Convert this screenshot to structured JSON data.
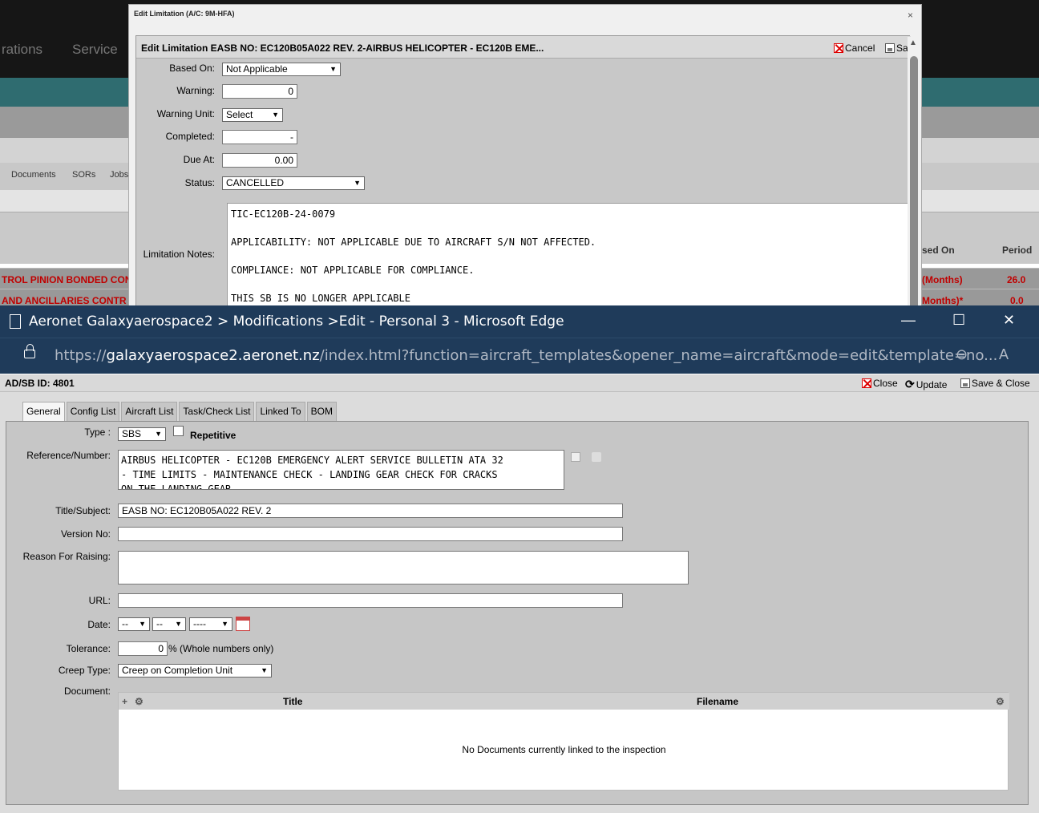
{
  "background_app": {
    "nav": [
      "rations",
      "Service"
    ],
    "tabs": [
      "Documents",
      "SORs",
      "Jobs"
    ],
    "column_headers": [
      "sed On",
      "Period"
    ],
    "rows": [
      {
        "left": "TROL PINION BONDED CON",
        "based_on": "(Months)",
        "period": "26.0"
      },
      {
        "left": "AND ANCILLARIES CONTR",
        "based_on": "Months)*",
        "period": "0.0"
      }
    ]
  },
  "limitation_dialog": {
    "window_title": "Edit Limitation (A/C: 9M-HFA)",
    "close_glyph": "×",
    "header_title": "Edit Limitation EASB NO: EC120B05A022 REV. 2-AIRBUS HELICOPTER - EC120B EME...",
    "cancel_label": "Cancel",
    "save_label": "Sa",
    "fields": {
      "based_on_label": "Based On:",
      "based_on_value": "Not Applicable",
      "warning_label": "Warning:",
      "warning_value": "0",
      "warning_unit_label": "Warning Unit:",
      "warning_unit_value": "Select",
      "completed_label": "Completed:",
      "completed_value": "-",
      "due_at_label": "Due At:",
      "due_at_value": "0.00",
      "status_label": "Status:",
      "status_value": "CANCELLED",
      "notes_label": "Limitation Notes:"
    },
    "notes": [
      "TIC-EC120B-24-0079",
      "APPLICABILITY: NOT APPLICABLE DUE TO AIRCRAFT S/N NOT AFFECTED.",
      "COMPLIANCE: NOT APPLICABLE FOR COMPLIANCE.",
      "THIS SB IS NO LONGER APPLICABLE"
    ]
  },
  "browser": {
    "title": "Aeronet Galaxyaerospace2 > Modifications >Edit - Personal 3 - Microsoft Edge",
    "url_prefix": "https://",
    "url_domain": "galaxyaerospace2.aeronet.nz",
    "url_rest": "/index.html?function=aircraft_templates&opener_name=aircraft&mode=edit&template=no...",
    "minimize_glyph": "—",
    "maximize_glyph": "☐",
    "close_glyph": "✕"
  },
  "adsb_page": {
    "id_label": "AD/SB ID: 4801",
    "close_label": "Close",
    "update_label": "Update",
    "save_close_label": "Save & Close",
    "tabs": [
      "General",
      "Config List",
      "Aircraft List",
      "Task/Check List",
      "Linked To",
      "BOM"
    ],
    "form": {
      "type_label": "Type :",
      "type_value": "SBS",
      "repetitive_label": "Repetitive",
      "reference_label": "Reference/Number:",
      "reference_lines": [
        "AIRBUS HELICOPTER - EC120B EMERGENCY ALERT SERVICE BULLETIN ATA 32",
        "- TIME LIMITS - MAINTENANCE CHECK - LANDING GEAR CHECK FOR CRACKS",
        "ON THE LANDING GEAR"
      ],
      "title_label": "Title/Subject:",
      "title_value": "EASB NO: EC120B05A022 REV. 2",
      "version_label": "Version No:",
      "version_value": "",
      "reason_label": "Reason For Raising:",
      "reason_value": "",
      "url_label": "URL:",
      "url_value": "",
      "date_label": "Date:",
      "date_day": "--",
      "date_month": "--",
      "date_year": "----",
      "tolerance_label": "Tolerance:",
      "tolerance_value": "0",
      "tolerance_suffix": "% (Whole numbers only)",
      "creep_label": "Creep Type:",
      "creep_value": "Creep on Completion Unit",
      "document_label": "Document:",
      "doc_columns": [
        "Title",
        "Filename"
      ],
      "doc_empty": "No Documents currently linked to the inspection"
    }
  }
}
